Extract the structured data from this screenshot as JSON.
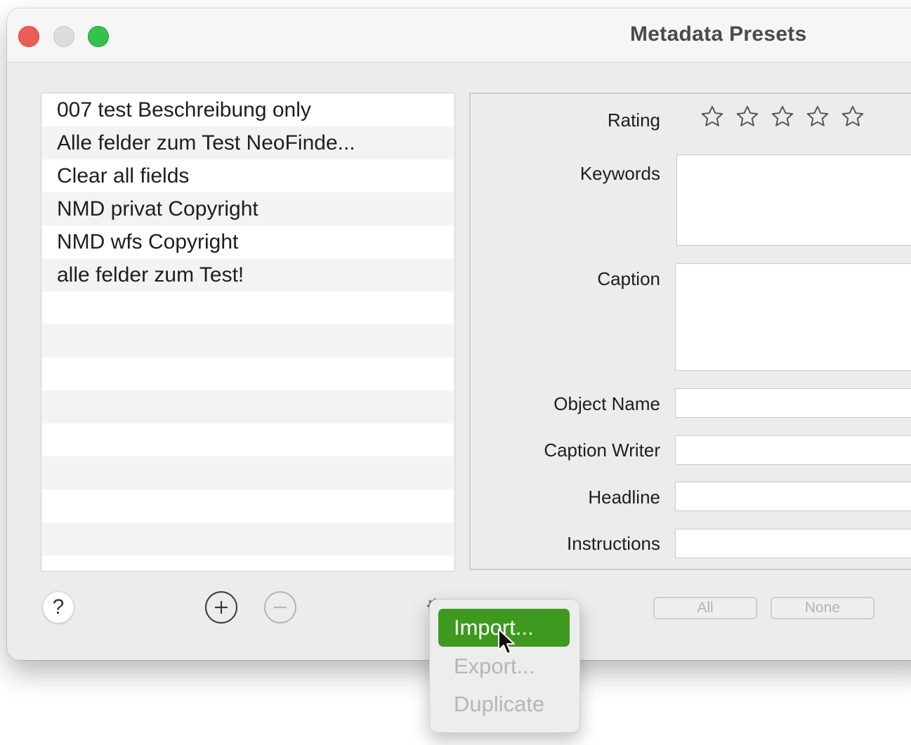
{
  "window": {
    "title": "Metadata Presets"
  },
  "presets": [
    "007 test Beschreibung only",
    "Alle felder zum Test NeoFinde...",
    "Clear all fields",
    "NMD privat Copyright",
    "NMD wfs Copyright",
    "alle felder zum Test!"
  ],
  "form": {
    "rating_label": "Rating",
    "rating_value": 0,
    "rating_max": 5,
    "keywords_label": "Keywords",
    "keywords_value": "",
    "caption_label": "Caption",
    "caption_value": "",
    "object_name_label": "Object Name",
    "object_name_value": "",
    "caption_writer_label": "Caption Writer",
    "caption_writer_value": "",
    "headline_label": "Headline",
    "headline_value": "",
    "instructions_label": "Instructions",
    "instructions_value": ""
  },
  "bottom": {
    "help_label": "?",
    "all_label": "All",
    "none_label": "None",
    "add_icon": "plus-circle-icon",
    "remove_icon": "minus-circle-icon",
    "gear_icon": "gear-icon"
  },
  "action_menu": {
    "import_label": "Import...",
    "export_label": "Export...",
    "duplicate_label": "Duplicate"
  },
  "colors": {
    "close": "#ee5d55",
    "zoom": "#33c24b",
    "menu_highlight": "#3d9a1f"
  }
}
